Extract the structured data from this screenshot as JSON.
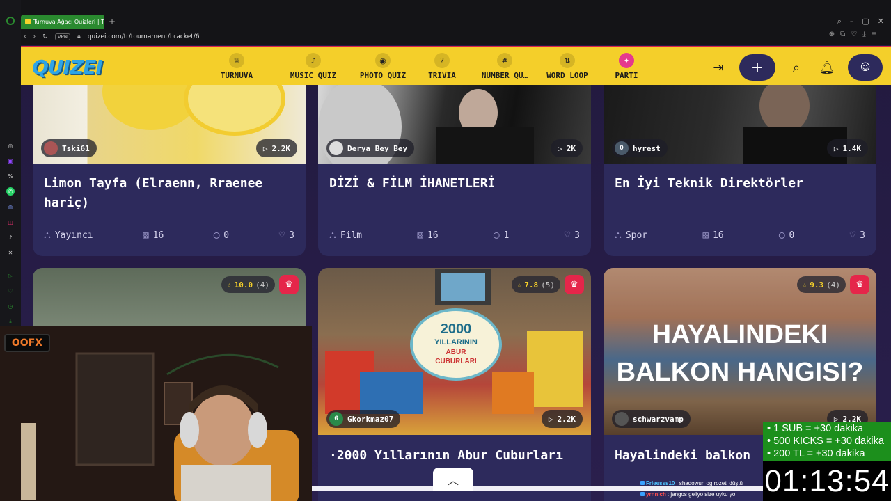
{
  "browser": {
    "tab_title": "Turnuva Ağacı Quizleri | Tu",
    "vpn_label": "VPN",
    "url": "quizei.com/tr/tournament/bracket/6",
    "new_tab": "+"
  },
  "header": {
    "logo": "QUIZEI",
    "nav": [
      {
        "label": "TURNUVA",
        "icon": "trophy-icon",
        "glyph": "♕"
      },
      {
        "label": "MUSIC QUIZ",
        "icon": "music-note-icon",
        "glyph": "♪"
      },
      {
        "label": "PHOTO QUIZ",
        "icon": "camera-icon",
        "glyph": "◉"
      },
      {
        "label": "TRIVIA",
        "icon": "question-bubble-icon",
        "glyph": "?"
      },
      {
        "label": "NUMBER QU…",
        "icon": "hash-icon",
        "glyph": "#"
      },
      {
        "label": "WORD LOOP",
        "icon": "sort-icon",
        "glyph": "⇅"
      },
      {
        "label": "PARTI",
        "icon": "party-icon",
        "glyph": "✦"
      }
    ],
    "login_glyph": "⇥",
    "add_glyph": "+",
    "search_glyph": "⌕",
    "bell_glyph": "♫",
    "user_glyph": "☺"
  },
  "cards": [
    {
      "author": "Tski61",
      "plays": "2.2K",
      "title": "Limon Tayfa (Elraenn, Rraenee hariç)",
      "category": "Yayıncı",
      "items": "16",
      "comments": "0",
      "likes": "3"
    },
    {
      "author": "Derya Bey Bey",
      "plays": "2K",
      "title": "DİZİ & FİLM İHANETLERİ",
      "category": "Film",
      "items": "16",
      "comments": "1",
      "likes": "3"
    },
    {
      "author": "hyrest",
      "avatar_letter": "O",
      "plays": "1.4K",
      "title": "En İyi Teknik Direktörler",
      "category": "Spor",
      "items": "16",
      "comments": "0",
      "likes": "3"
    },
    {
      "rating": "10.0",
      "rating_count": "(4)"
    },
    {
      "rating": "7.8",
      "rating_count": "(5)",
      "author": "Gkorkmaz07",
      "avatar_letter": "G",
      "plays": "2.2K",
      "title": "·2000 Yıllarının Abur Cuburları",
      "thumb_text_1": "2000",
      "thumb_text_2": "YILLARININ",
      "thumb_text_3": "ABUR",
      "thumb_text_4": "CUBURLARI"
    },
    {
      "rating": "9.3",
      "rating_count": "(4)",
      "author": "schwarzvamp",
      "plays": "2.2K",
      "title": "Hayalindeki balkon",
      "thumb_line1": "HAYALINDEKI",
      "thumb_line2": "BALKON HANGISI?"
    }
  ],
  "overlay": {
    "sub_lines": [
      "• 1 SUB = +30 dakika",
      "• 500 KICKS = +30 dakika",
      "• 200 TL = +30 dakika"
    ],
    "timer": "01:13:54",
    "chat": [
      {
        "user": "Frieesss10",
        "msg": ": shadowun og rozeti düştü"
      },
      {
        "user": "yrnnich",
        "msg": ": jangos geliyo size uyku yo"
      }
    ],
    "cam_logo": "OOFX"
  },
  "colors": {
    "brand_yellow": "#f4cf2a",
    "card_bg": "#2d2a5c",
    "accent_red": "#e5264a"
  }
}
